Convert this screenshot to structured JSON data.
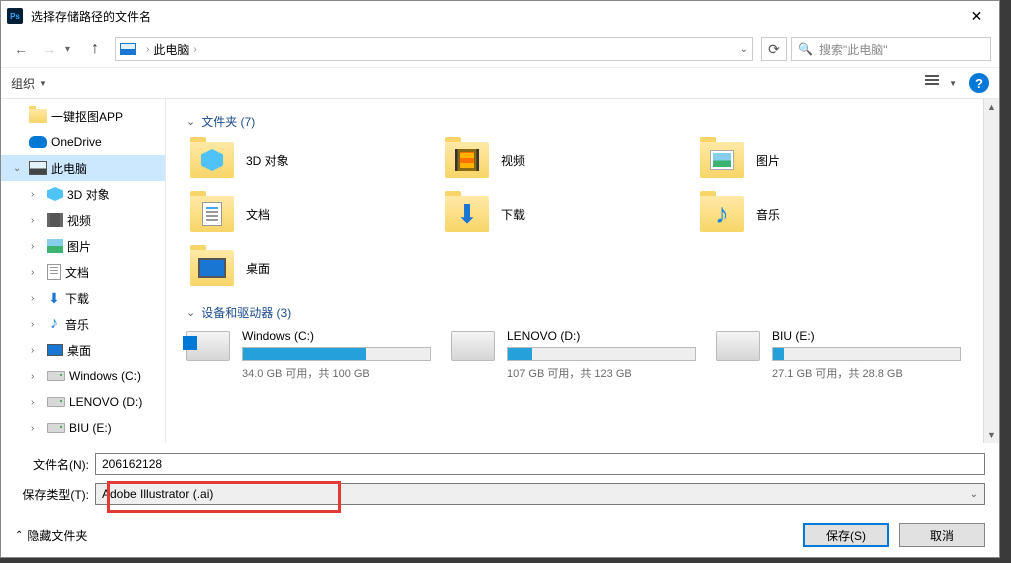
{
  "title": "选择存储路径的文件名",
  "address": {
    "location": "此电脑"
  },
  "search": {
    "placeholder": "搜索\"此电脑\""
  },
  "toolbar": {
    "organize": "组织"
  },
  "sidebar": {
    "items": [
      {
        "label": "一键抠图APP",
        "type": "folder"
      },
      {
        "label": "OneDrive",
        "type": "onedrive"
      },
      {
        "label": "此电脑",
        "type": "pc",
        "selected": true,
        "expanded": true
      },
      {
        "label": "3D 对象",
        "type": "3d",
        "sub": true
      },
      {
        "label": "视频",
        "type": "video",
        "sub": true
      },
      {
        "label": "图片",
        "type": "image",
        "sub": true
      },
      {
        "label": "文档",
        "type": "doc",
        "sub": true
      },
      {
        "label": "下载",
        "type": "download",
        "sub": true
      },
      {
        "label": "音乐",
        "type": "music",
        "sub": true
      },
      {
        "label": "桌面",
        "type": "desktop",
        "sub": true
      },
      {
        "label": "Windows (C:)",
        "type": "drive",
        "sub": true
      },
      {
        "label": "LENOVO (D:)",
        "type": "drive",
        "sub": true
      },
      {
        "label": "BIU (E:)",
        "type": "drive",
        "sub": true
      }
    ]
  },
  "groups": {
    "folders": {
      "header": "文件夹 (7)",
      "items": [
        {
          "label": "3D 对象",
          "badge": "3d"
        },
        {
          "label": "视频",
          "badge": "video"
        },
        {
          "label": "图片",
          "badge": "pic"
        },
        {
          "label": "文档",
          "badge": "doc"
        },
        {
          "label": "下载",
          "badge": "dl"
        },
        {
          "label": "音乐",
          "badge": "music"
        },
        {
          "label": "桌面",
          "badge": "desktop"
        }
      ]
    },
    "drives": {
      "header": "设备和驱动器 (3)",
      "items": [
        {
          "name": "Windows (C:)",
          "text": "34.0 GB 可用，共 100 GB",
          "fill": 66,
          "win": true
        },
        {
          "name": "LENOVO (D:)",
          "text": "107 GB 可用，共 123 GB",
          "fill": 13
        },
        {
          "name": "BIU (E:)",
          "text": "27.1 GB 可用，共 28.8 GB",
          "fill": 6
        }
      ]
    }
  },
  "form": {
    "filename_label": "文件名(N):",
    "filename_value": "206162128",
    "filetype_label": "保存类型(T):",
    "filetype_value": "Adobe Illustrator (.ai)"
  },
  "footer": {
    "hide_folders": "隐藏文件夹",
    "save": "保存(S)",
    "cancel": "取消"
  }
}
